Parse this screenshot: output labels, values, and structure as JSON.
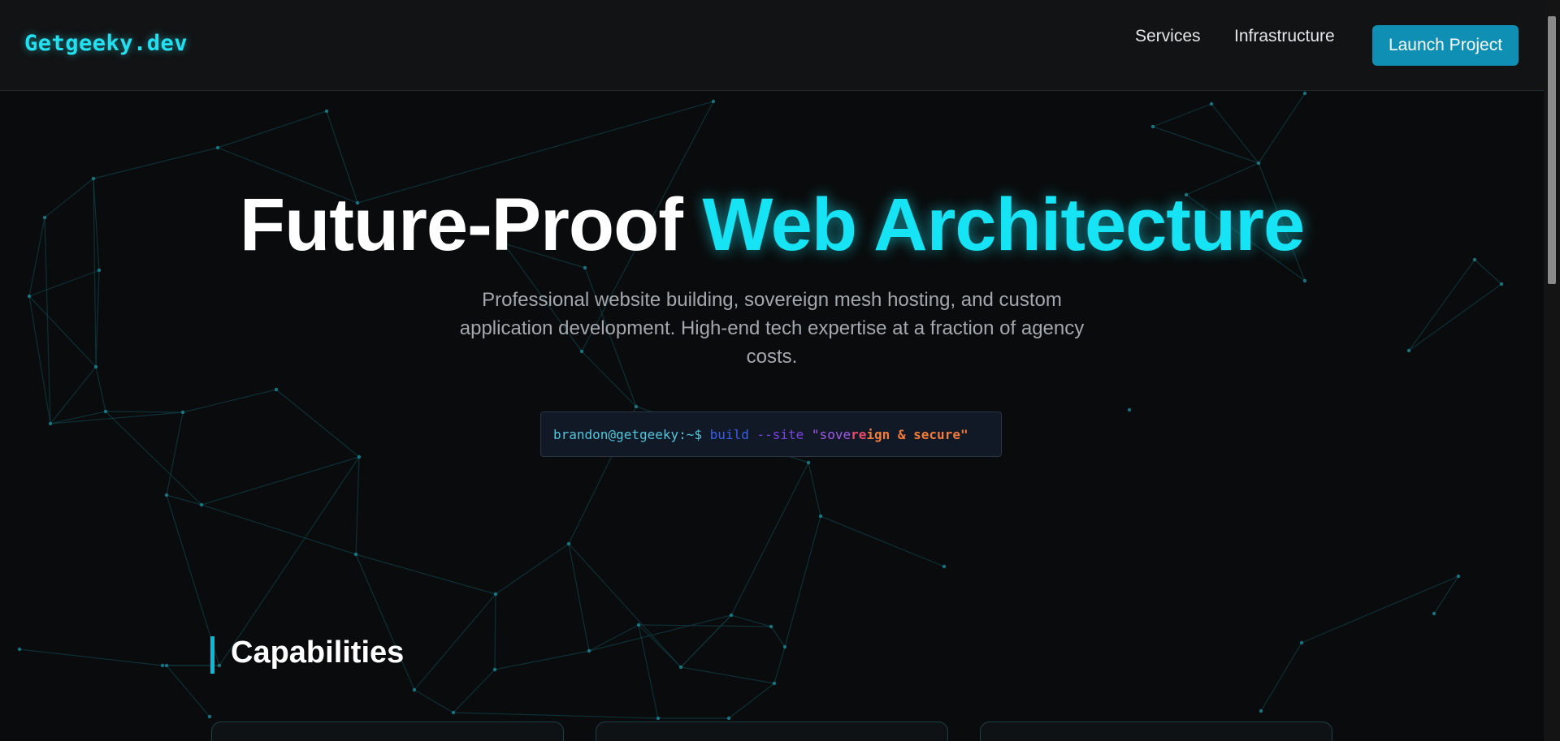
{
  "header": {
    "logo": "Getgeeky.dev",
    "nav": {
      "services": "Services",
      "infrastructure": "Infrastructure"
    },
    "cta_label": "Launch Project"
  },
  "hero": {
    "title_part1": "Future-Proof ",
    "title_part2": "Web Architecture",
    "subtitle": "Professional website building, sovereign mesh hosting, and custom application development. High-end tech expertise at a fraction of agency costs."
  },
  "terminal": {
    "prompt": "brandon@getgeeky:~$",
    "command": "build",
    "flag": "--site",
    "string_parts": [
      "\"sove",
      "re",
      "ign & ",
      "secure\""
    ]
  },
  "capabilities": {
    "heading": "Capabilities"
  },
  "colors": {
    "accent": "#16e3f3",
    "button": "#0e8fb3",
    "background": "#0a0b0c",
    "mesh_line": "#0f3d44"
  }
}
